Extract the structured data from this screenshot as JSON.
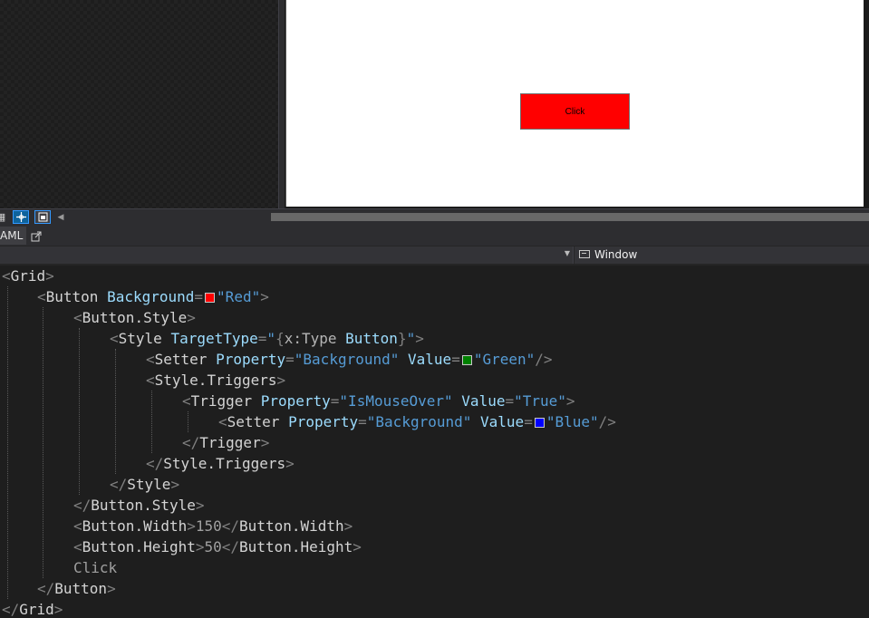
{
  "designer": {
    "button_label": "Click",
    "button_color": "#ff0000"
  },
  "toolbar": {
    "icons": [
      "grid-icon",
      "snap-icon",
      "layout-icon",
      "scroll-left-icon"
    ]
  },
  "tabs": {
    "xaml_label": "AML",
    "popout_icon": "popout-icon"
  },
  "navbar": {
    "element_selector": "Window"
  },
  "code": {
    "l1": {
      "open": "<",
      "tag": "Grid",
      "close": ">"
    },
    "l2": {
      "open": "<",
      "tag": "Button",
      "attr": "Background",
      "eq": "=",
      "val": "\"Red\"",
      "close": ">",
      "swatch": "#ff0000"
    },
    "l3": {
      "open": "<",
      "tag": "Button.Style",
      "close": ">"
    },
    "l4": {
      "open": "<",
      "tag": "Style",
      "attr": "TargetType",
      "eq": "=",
      "q1": "\"",
      "brace1": "{",
      "ext": "x:Type",
      "sp": " ",
      "extval": "Button",
      "brace2": "}",
      "q2": "\"",
      "close": ">"
    },
    "l5": {
      "open": "<",
      "tag": "Setter",
      "attr1": "Property",
      "eq1": "=",
      "val1": "\"Background\"",
      "attr2": "Value",
      "eq2": "=",
      "val2": "\"Green\"",
      "close": "/>",
      "swatch": "#008000"
    },
    "l6": {
      "open": "<",
      "tag": "Style.Triggers",
      "close": ">"
    },
    "l7": {
      "open": "<",
      "tag": "Trigger",
      "attr1": "Property",
      "eq1": "=",
      "val1": "\"IsMouseOver\"",
      "attr2": "Value",
      "eq2": "=",
      "val2": "\"True\"",
      "close": ">"
    },
    "l8": {
      "open": "<",
      "tag": "Setter",
      "attr1": "Property",
      "eq1": "=",
      "val1": "\"Background\"",
      "attr2": "Value",
      "eq2": "=",
      "val2": "\"Blue\"",
      "close": "/>",
      "swatch": "#0000ff"
    },
    "l9": {
      "open": "</",
      "tag": "Trigger",
      "close": ">"
    },
    "l10": {
      "open": "</",
      "tag": "Style.Triggers",
      "close": ">"
    },
    "l11": {
      "open": "</",
      "tag": "Style",
      "close": ">"
    },
    "l12": {
      "open": "</",
      "tag": "Button.Style",
      "close": ">"
    },
    "l13": {
      "open": "<",
      "tag": "Button.Width",
      "close": ">",
      "content": "150",
      "open2": "</",
      "tag2": "Button.Width",
      "close2": ">"
    },
    "l14": {
      "open": "<",
      "tag": "Button.Height",
      "close": ">",
      "content": "50",
      "open2": "</",
      "tag2": "Button.Height",
      "close2": ">"
    },
    "l15": {
      "text": "Click"
    },
    "l16": {
      "open": "</",
      "tag": "Button",
      "close": ">"
    },
    "l17": {
      "open": "</",
      "tag": "Grid",
      "close": ">"
    }
  }
}
